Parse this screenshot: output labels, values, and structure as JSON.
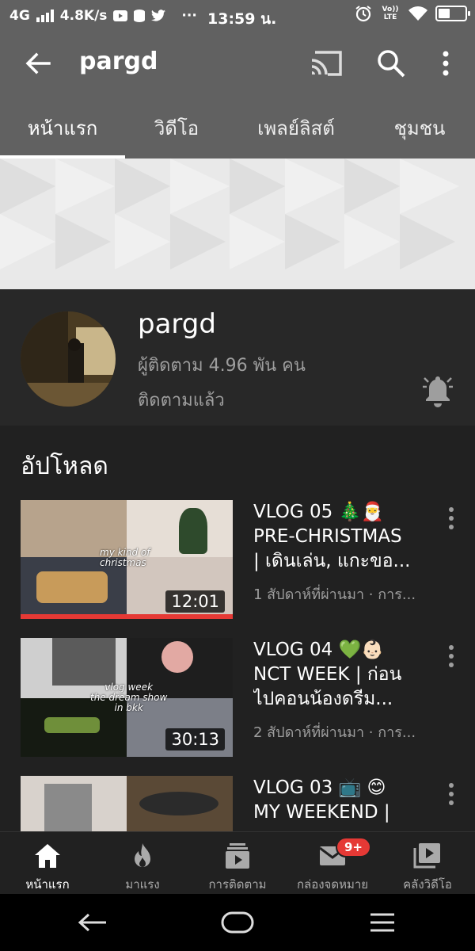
{
  "status_bar": {
    "network": "4G",
    "speed": "4.8K/s",
    "more": "···",
    "time": "13:59 น.",
    "volte": "Vo)) LTE"
  },
  "app_bar": {
    "title": "pargd"
  },
  "tabs": [
    {
      "label": "หน้าแรก",
      "active": true
    },
    {
      "label": "วิดีโอ",
      "active": false
    },
    {
      "label": "เพลย์ลิสต์",
      "active": false
    },
    {
      "label": "ชุมชน",
      "active": false
    }
  ],
  "channel": {
    "name": "pargd",
    "subscribers": "ผู้ติดตาม 4.96 พัน คน",
    "status": "ติดตามแล้ว"
  },
  "uploads": {
    "title": "อัปโหลด",
    "videos": [
      {
        "title_lines": [
          "VLOG 05 🎄🎅",
          "PRE-CHRISTMAS",
          "| เดินเล่น, แกะขอ..."
        ],
        "meta": "1 สัปดาห์ที่ผ่านมา · การ...",
        "duration": "12:01",
        "overlay": "my kind of\nchristmas",
        "watched_fraction": 1.0
      },
      {
        "title_lines": [
          "VLOG 04 💚👶🏻",
          "NCT WEEK | ก่อน",
          "ไปคอนน้องดรีม..."
        ],
        "meta": "2 สัปดาห์ที่ผ่านมา · การ...",
        "duration": "30:13",
        "overlay": "vlog week\nthe dream show\nin bkk",
        "watched_fraction": 0
      },
      {
        "title_lines": [
          "VLOG 03 📺 😊",
          "MY WEEKEND |"
        ],
        "meta": "",
        "duration": "",
        "overlay": "",
        "watched_fraction": 0
      }
    ]
  },
  "bottom_nav": [
    {
      "label": "หน้าแรก",
      "icon": "home-icon",
      "active": true
    },
    {
      "label": "มาแรง",
      "icon": "trending-flame-icon",
      "active": false
    },
    {
      "label": "การติดตาม",
      "icon": "subscriptions-icon",
      "active": false
    },
    {
      "label": "กล่องจดหมาย",
      "icon": "inbox-mail-icon",
      "active": false,
      "badge": "9+"
    },
    {
      "label": "คลังวิดีโอ",
      "icon": "library-icon",
      "active": false
    }
  ],
  "colors": {
    "bar_gray": "#616161",
    "background": "#212121",
    "header": "#282828",
    "accent_red": "#e53935",
    "secondary_text": "#9e9e9e"
  }
}
